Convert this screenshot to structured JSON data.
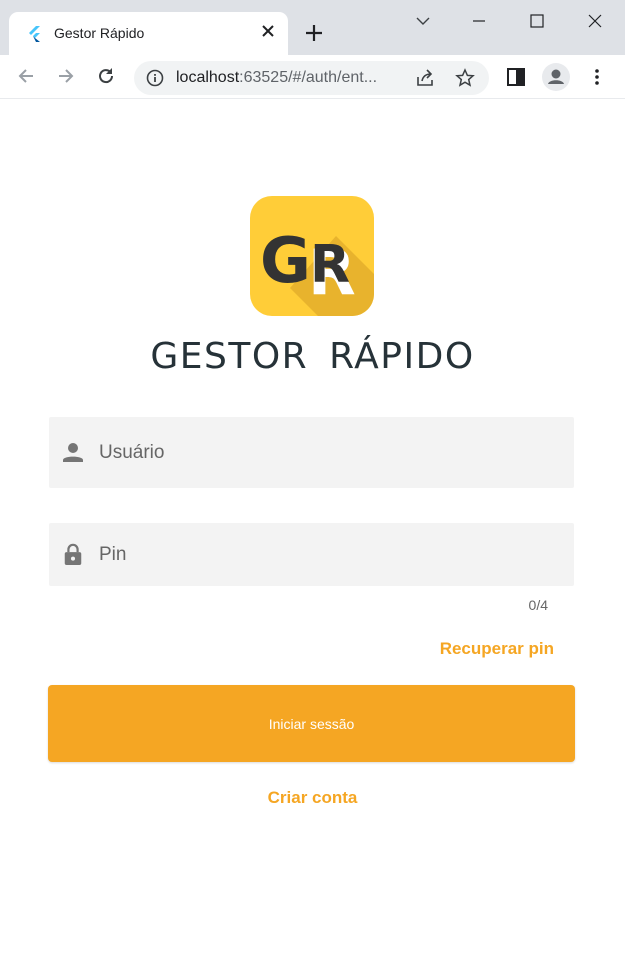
{
  "browser": {
    "tab_title": "Gestor Rápido",
    "url_host": "localhost",
    "url_rest": ":63525/#/auth/ent..."
  },
  "app": {
    "logo_text": "GR",
    "title": "GESTOR RÁPIDO"
  },
  "form": {
    "user_placeholder": "Usuário",
    "user_value": "",
    "pin_placeholder": "Pin",
    "pin_value": "",
    "pin_counter": "0/4",
    "recover_label": "Recuperar pin",
    "submit_label": "Iniciar sessão",
    "create_label": "Criar conta"
  },
  "colors": {
    "accent": "#f5a623",
    "logo_yellow": "#ffcd38",
    "title": "#263238",
    "field_bg": "#f3f3f3"
  },
  "icons": {
    "user_field": "person-icon",
    "pin_field": "lock-icon"
  }
}
